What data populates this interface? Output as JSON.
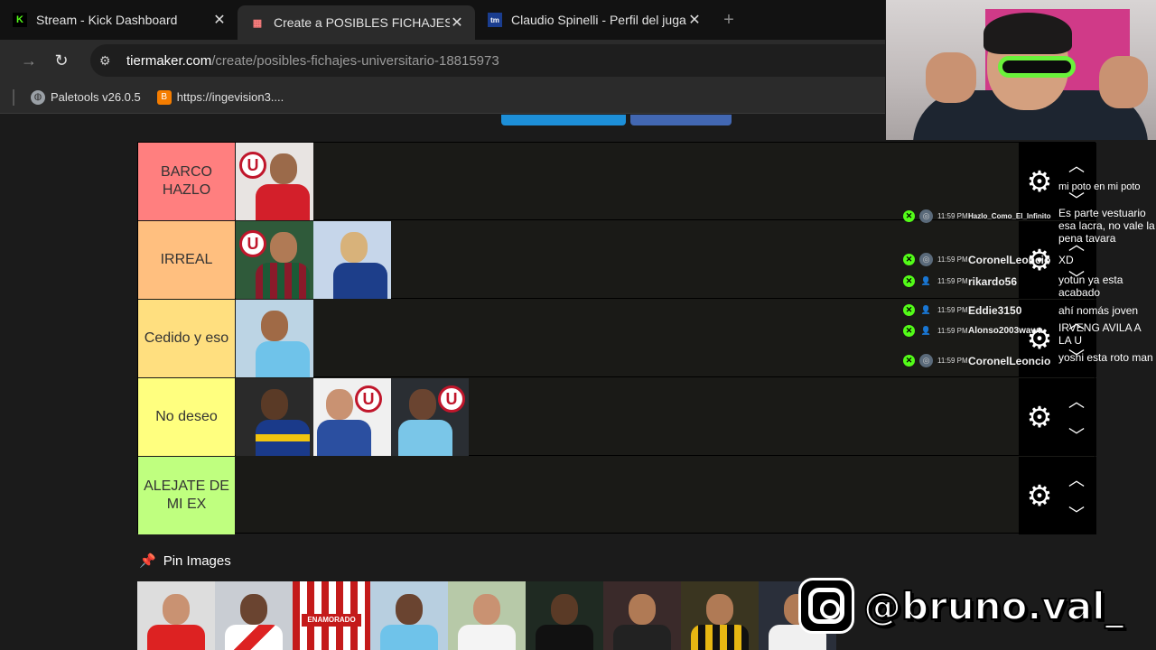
{
  "browser": {
    "tabs": [
      {
        "title": "Stream - Kick Dashboard",
        "favicon": "K",
        "favicon_color": "#53fc18",
        "active": false
      },
      {
        "title": "Create a POSIBLES FICHAJES UNI",
        "favicon": "▦",
        "favicon_color": "#ff7f7f",
        "active": true
      },
      {
        "title": "Claudio Spinelli - Perfil del juga",
        "favicon": "tm",
        "favicon_color": "#1a3d8f",
        "active": false
      }
    ],
    "url_host": "tiermaker.com",
    "url_path": "/create/posibles-fichajes-universitario-18815973",
    "bookmarks": [
      {
        "label": "Paletools v26.0.5",
        "icon": "globe-icon",
        "color": "#9aa0a6"
      },
      {
        "label": "https://ingevision3....",
        "icon": "blogger-icon",
        "color": "#f57d00"
      }
    ]
  },
  "tiers": [
    {
      "label": "BARCO HAZLO",
      "color": "#ff7f7f",
      "items": [
        "player-1"
      ]
    },
    {
      "label": "IRREAL",
      "color": "#ffbf7f",
      "items": [
        "player-2",
        "player-3"
      ]
    },
    {
      "label": "Cedido y eso",
      "color": "#ffdf7f",
      "items": [
        "player-4"
      ]
    },
    {
      "label": "No deseo",
      "color": "#ffff7f",
      "items": [
        "player-5",
        "player-6",
        "player-7"
      ]
    },
    {
      "label": "ALEJATE DE MI EX",
      "color": "#bfff7f",
      "items": []
    }
  ],
  "pin_section": {
    "title": "Pin Images"
  },
  "chat": {
    "messages": [
      {
        "time": "11:59 PM",
        "user": "",
        "text": "mi poto en mi poto"
      },
      {
        "time": "11:59 PM",
        "user": "Hazlo_Como_El_Infinito",
        "text": "Es parte vestuario esa lacra, no vale la pena tavara"
      },
      {
        "time": "11:59 PM",
        "user": "CoronelLeoncio",
        "text": "XD"
      },
      {
        "time": "11:59 PM",
        "user": "rikardo56",
        "text": "yotun ya esta acabado"
      },
      {
        "time": "11:59 PM",
        "user": "Eddie3150",
        "text": "ahí nomás joven"
      },
      {
        "time": "11:59 PM",
        "user": "Alonso2003wawa",
        "text": "IRVENG AVILA A LA U"
      },
      {
        "time": "11:59 PM",
        "user": "CoronelLeoncio",
        "text": "yoshi esta roto man"
      }
    ]
  },
  "watermark": {
    "handle": "@bruno.val_"
  }
}
